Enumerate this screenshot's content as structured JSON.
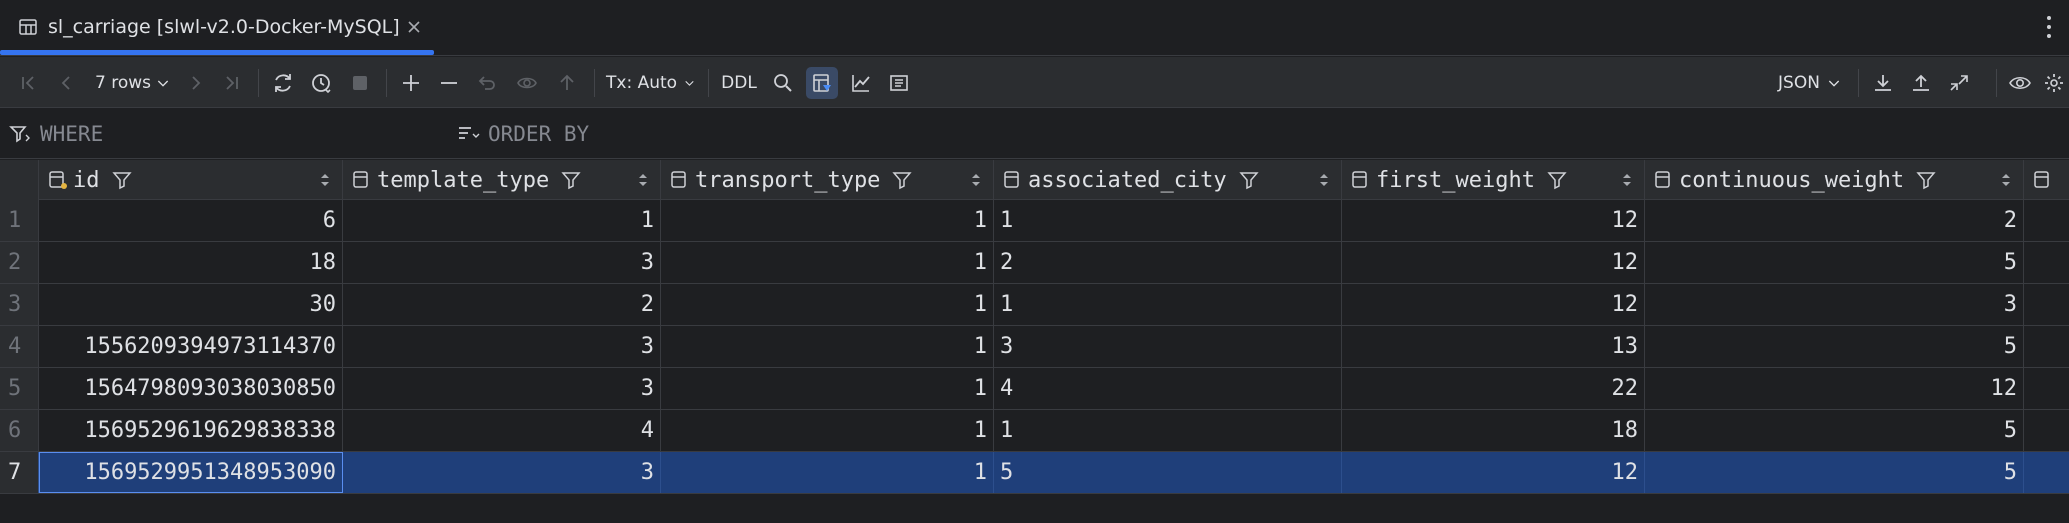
{
  "tab": {
    "title": "sl_carriage [slwl-v2.0-Docker-MySQL]",
    "accent_color": "#3574f0"
  },
  "toolbar": {
    "rows_label": "7 rows",
    "tx_label": "Tx: Auto",
    "ddl_label": "DDL",
    "format_label": "JSON"
  },
  "filter": {
    "where_label": "WHERE",
    "order_label": "ORDER BY"
  },
  "columns": [
    {
      "name": "id"
    },
    {
      "name": "template_type"
    },
    {
      "name": "transport_type"
    },
    {
      "name": "associated_city"
    },
    {
      "name": "first_weight"
    },
    {
      "name": "continuous_weight"
    }
  ],
  "rows": [
    {
      "num": "1",
      "cells": [
        "6",
        "1",
        "1",
        "1",
        "12",
        "2"
      ]
    },
    {
      "num": "2",
      "cells": [
        "18",
        "3",
        "1",
        "2",
        "12",
        "5"
      ]
    },
    {
      "num": "3",
      "cells": [
        "30",
        "2",
        "1",
        "1",
        "12",
        "3"
      ]
    },
    {
      "num": "4",
      "cells": [
        "1556209394973114370",
        "3",
        "1",
        "3",
        "13",
        "5"
      ]
    },
    {
      "num": "5",
      "cells": [
        "1564798093038030850",
        "3",
        "1",
        "4",
        "22",
        "12"
      ]
    },
    {
      "num": "6",
      "cells": [
        "1569529619629838338",
        "4",
        "1",
        "1",
        "18",
        "5"
      ]
    },
    {
      "num": "7",
      "cells": [
        "1569529951348953090",
        "3",
        "1",
        "5",
        "12",
        "5"
      ]
    }
  ],
  "selected_row": 7,
  "colors": {
    "background": "#1e1f22",
    "panel": "#2b2d30",
    "selection": "#1f3f7a",
    "text": "#dfe1e5"
  }
}
